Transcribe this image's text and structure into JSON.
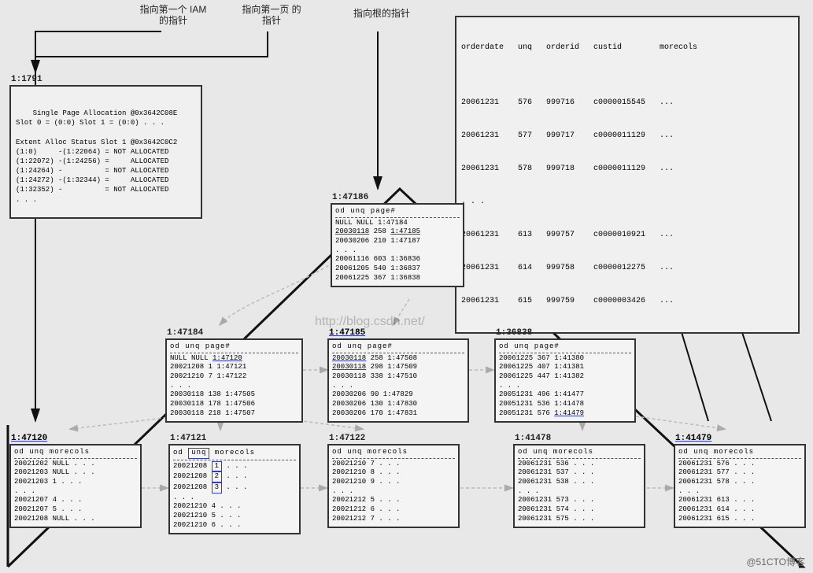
{
  "labels": {
    "iamPtr": "指向第一个\nIAM的指针",
    "firstPagePtr": "指向第一页\n的指针",
    "rootPtr": "指向根的指针"
  },
  "iamBox": {
    "id": "1:1791",
    "body": "Single Page Allocation @0x3642C08E\nSlot 0 = (0:0) Slot 1 = (0:0) . . .\n\nExtent Alloc Status Slot 1 @0x3642C0C2\n(1:0)     -(1:22064) = NOT ALLOCATED\n(1:22072) -(1:24256) =     ALLOCATED\n(1:24264) -          = NOT ALLOCATED\n(1:24272) -(1:32344) =     ALLOCATED\n(1:32352) -          = NOT ALLOCATED\n. . ."
  },
  "rowbox": {
    "h": "orderdate   unq   orderid   custid        morecols",
    "r1": "20061231    576   999716    c0000015545   ...",
    "r2": "20061231    577   999717    c0000011129   ...",
    "r3": "20061231    578   999718    c0000011129   ...",
    "dots": ". . .",
    "r4": "20061231    613   999757    c0000010921   ...",
    "r5": "20061231    614   999758    c0000012275   ...",
    "r6": "20061231    615   999759    c0000003426   ..."
  },
  "root": {
    "id": "1:47186",
    "hdr": "od        unq   page#",
    "a1": "NULL      NULL  1:47184",
    "a2a": "20030118",
    "a2b": "  258  ",
    "a2c": "1:47185",
    "a3": "20030206   210  1:47187",
    "dots": ". . .",
    "b1": "20061116   603  1:36836",
    "b2": "20061205   540  1:36837",
    "b3": "20061225   367  1:36838"
  },
  "lvl2": {
    "p1": {
      "id": "1:47184",
      "hdr": "od        unq   page#",
      "a1a": "NULL      NULL  ",
      "a1b": "1:47120",
      "a2": "20021208     1  1:47121",
      "a3": "20021210     7  1:47122",
      "dots": ". . .",
      "b1": "20030118   138  1:47505",
      "b2": "20030118   178  1:47506",
      "b3": "20030118   218  1:47507"
    },
    "p2": {
      "id": "1:47185",
      "hdr": "od        unq   page#",
      "a1a": "20030118",
      "a1b": "   258  1:47508",
      "a2a": "20030118",
      "a2b": "   298  1:47509",
      "a3": "20030118   338  1:47510",
      "dots": ". . .",
      "b1": "20030206    90  1:47829",
      "b2": "20030206   130  1:47830",
      "b3": "20030206   170  1:47831"
    },
    "p3": {
      "id": "1:36838",
      "hdr": "od        unq   page#",
      "a1": "20061225   367  1:41380",
      "a2": "20061225   407  1:41381",
      "a3": "20061225   447  1:41382",
      "dots": ". . .",
      "b1": "20051231   496  1:41477",
      "b2": "20051231   536  1:41478",
      "b3a": "20051231   576  ",
      "b3b": "1:41479"
    }
  },
  "leaf": {
    "p1": {
      "id": "1:47120",
      "hdr": "od        unq  morecols",
      "a1": "20021202  NULL  . . .",
      "a2": "20021203  NULL  . . .",
      "a3": "20021203    1   . . .",
      "dots": ". . .",
      "b1": "20021207    4   . . .",
      "b2": "20021207    5   . . .",
      "b3": "20021208  NULL  . . ."
    },
    "p2": {
      "id": "1:47121",
      "hdrA": "od       ",
      "hdrB": "unq",
      "hdrC": "  morecols",
      "a1a": "20021208   ",
      "a1b": "1",
      "a1c": "  . . .",
      "a2a": "20021208   ",
      "a2b": "2",
      "a2c": "  . . .",
      "a3a": "20021208   ",
      "a3b": "3",
      "a3c": "  . . .",
      "dots": ". . .",
      "b1": "20021210    4   . . .",
      "b2": "20021210    5   . . .",
      "b3": "20021210    6   . . ."
    },
    "p3": {
      "id": "1:47122",
      "hdr": "od        unq  morecols",
      "a1": "20021210    7   . . .",
      "a2": "20021210    8   . . .",
      "a3": "20021210    9   . . .",
      "dots": ". . .",
      "b1": "20021212    5   . . .",
      "b2": "20021212    6   . . .",
      "b3": "20021212    7   . . ."
    },
    "p4": {
      "id": "1:41478",
      "hdr": "od        unq  morecols",
      "a1": "20061231   536  . . .",
      "a2": "20061231   537  . . .",
      "a3": "20061231   538  . . .",
      "dots": ". . .",
      "b1": "20061231   573  . . .",
      "b2": "20061231   574  . . .",
      "b3": "20061231   575  . . ."
    },
    "p5": {
      "id": "1:41479",
      "hdr": "od        unq  morecols",
      "a1": "20061231   576  . . .",
      "a2": "20061231   577  . . .",
      "a3": "20061231   578  . . .",
      "dots": ". . .",
      "b1": "20061231   613  . . .",
      "b2": "20061231   614  . . .",
      "b3": "20061231   615  . . ."
    }
  },
  "watermark": "http://blog.csdn.net/",
  "credit": "@51CTO博客"
}
